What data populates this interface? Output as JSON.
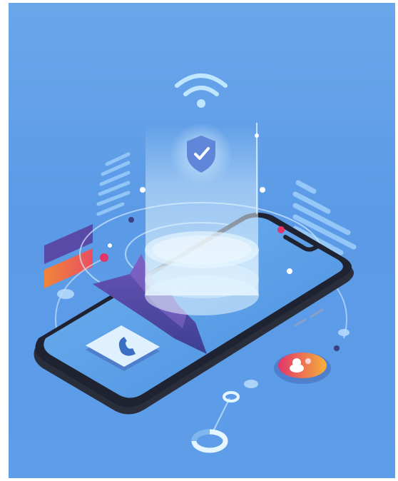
{
  "scene": {
    "background": "#5f9ee8",
    "accent_dark": "#3b3f86",
    "accent_purple": "#6a4fb0",
    "accent_orange": "#f08a3c",
    "accent_pink": "#e2356a",
    "glow": "#d9f0ff"
  },
  "icons": {
    "wifi": "wifi-icon",
    "shield": "shield-check-icon",
    "phone": "phone-call-icon",
    "users": "users-icon",
    "donut": "donut-chart-icon"
  }
}
